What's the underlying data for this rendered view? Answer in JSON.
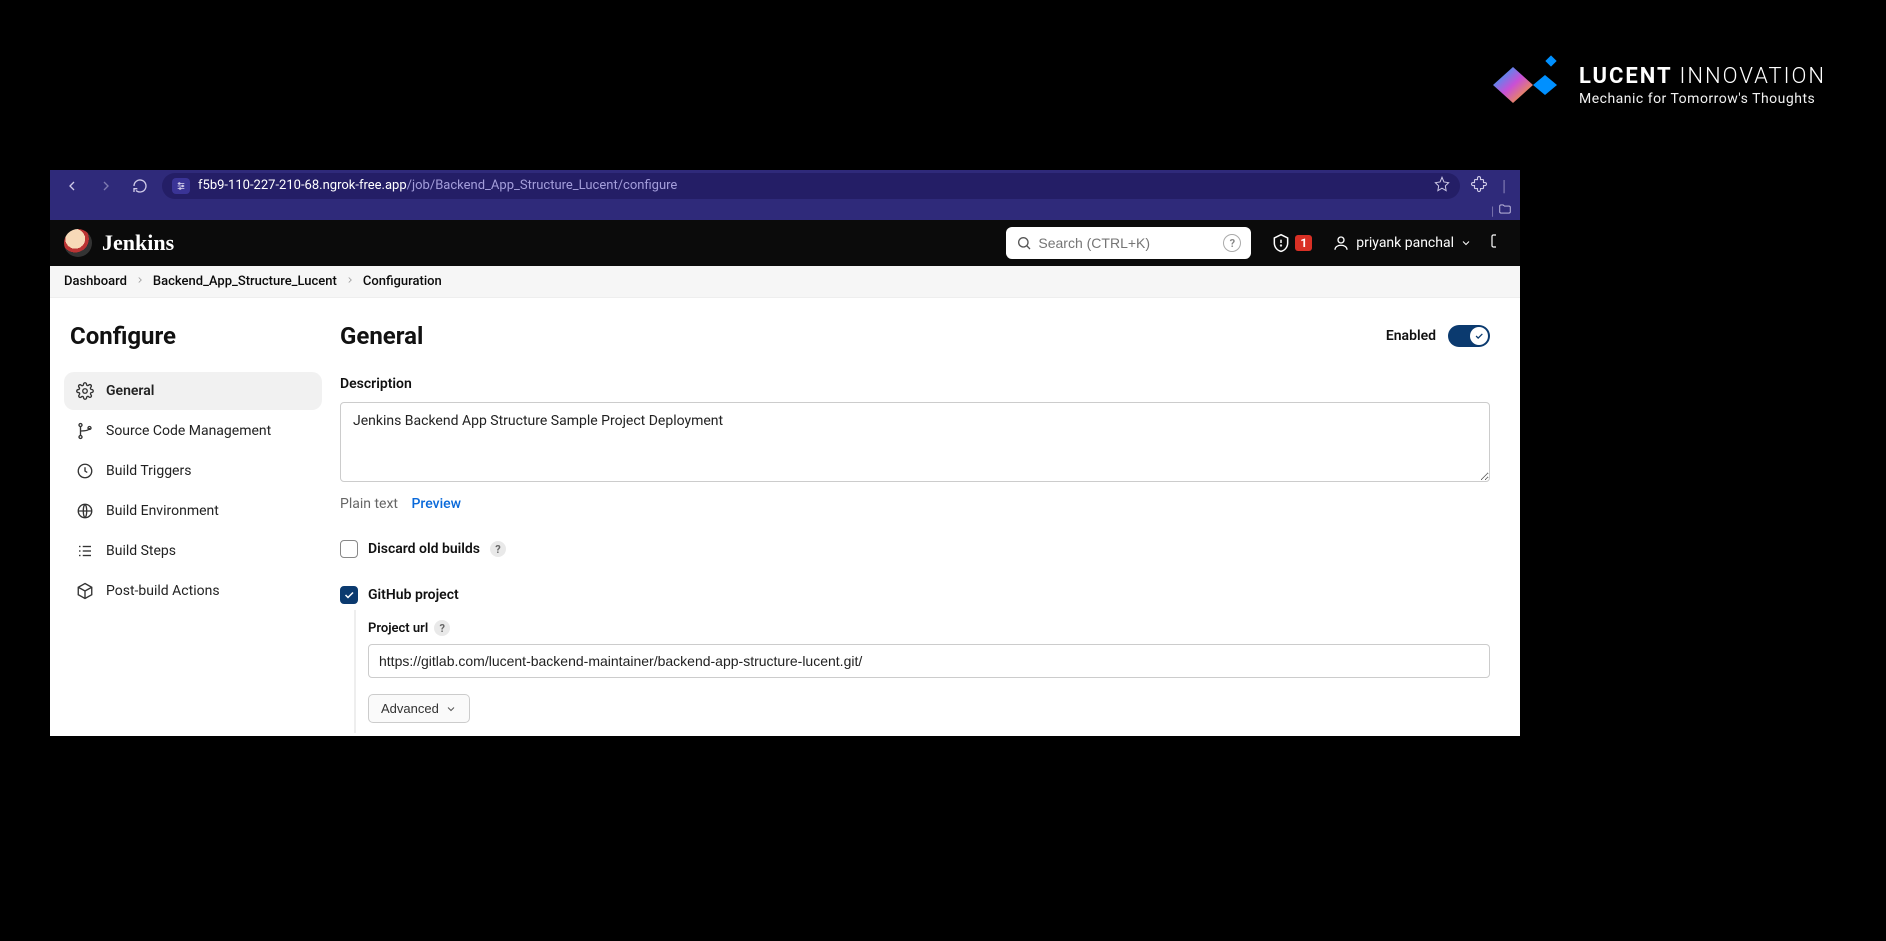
{
  "brand": {
    "name_bold": "LUCENT",
    "name_light": "INNOVATION",
    "tagline": "Mechanic for Tomorrow's Thoughts"
  },
  "browser": {
    "host": "f5b9-110-227-210-68.ngrok-free.app",
    "path": "/job/Backend_App_Structure_Lucent/configure"
  },
  "jenkins": {
    "title": "Jenkins",
    "search_placeholder": "Search (CTRL+K)",
    "alert_count": "1",
    "user_name": "priyank panchal"
  },
  "breadcrumb": {
    "items": [
      "Dashboard",
      "Backend_App_Structure_Lucent",
      "Configuration"
    ]
  },
  "sidebar": {
    "title": "Configure",
    "items": [
      {
        "label": "General",
        "icon": "gear-icon",
        "active": true
      },
      {
        "label": "Source Code Management",
        "icon": "branch-icon",
        "active": false
      },
      {
        "label": "Build Triggers",
        "icon": "clock-icon",
        "active": false
      },
      {
        "label": "Build Environment",
        "icon": "globe-icon",
        "active": false
      },
      {
        "label": "Build Steps",
        "icon": "steps-icon",
        "active": false
      },
      {
        "label": "Post-build Actions",
        "icon": "cube-icon",
        "active": false
      }
    ]
  },
  "main": {
    "heading": "General",
    "enabled_label": "Enabled",
    "enabled_value": true,
    "description_label": "Description",
    "description_value": "Jenkins Backend App Structure Sample Project Deployment",
    "plain_text_label": "Plain text",
    "preview_label": "Preview",
    "discard_label": "Discard old builds",
    "discard_checked": false,
    "github_label": "GitHub project",
    "github_checked": true,
    "project_url_label": "Project url",
    "project_url_value": "https://gitlab.com/lucent-backend-maintainer/backend-app-structure-lucent.git/",
    "advanced_label": "Advanced"
  }
}
